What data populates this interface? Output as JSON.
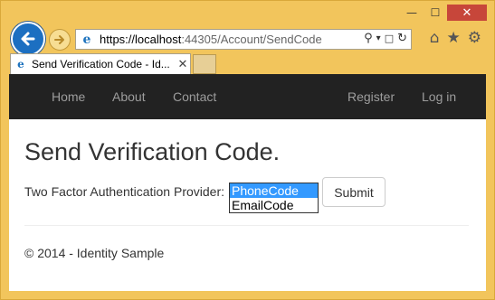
{
  "window": {
    "minimize_glyph": "—",
    "maximize_glyph": "☐",
    "close_glyph": "✕"
  },
  "toolbar": {
    "back_icon": "back-arrow-icon",
    "forward_icon": "forward-arrow-icon",
    "right_icons": [
      "home-icon",
      "favorites-star-icon",
      "settings-gear-icon"
    ],
    "home_glyph": "⌂",
    "star_glyph": "★",
    "gear_glyph": "⚙"
  },
  "address": {
    "scheme_host": "https://localhost",
    "rest": ":44305/Account/SendCode",
    "search_glyph": "⚲",
    "dropdown_glyph": "▾",
    "lock_glyph": "🔒",
    "refresh_glyph": "↻"
  },
  "tab": {
    "title": "Send Verification Code - Id...",
    "close_glyph": "✕"
  },
  "nav": {
    "left": [
      "Home",
      "About",
      "Contact"
    ],
    "right": [
      "Register",
      "Log in"
    ]
  },
  "page": {
    "title": "Send Verification Code.",
    "provider_label": "Two Factor Authentication Provider:",
    "provider_options": [
      "PhoneCode",
      "EmailCode"
    ],
    "selected_option": "PhoneCode",
    "submit_label": "Submit",
    "footer": "© 2014 - Identity Sample"
  },
  "colors": {
    "window_frame": "#f2c55c",
    "navbar": "#222222",
    "nav_link": "#9d9d9d",
    "selected_option_bg": "#3399ff",
    "back_button": "#1c6fc1"
  }
}
